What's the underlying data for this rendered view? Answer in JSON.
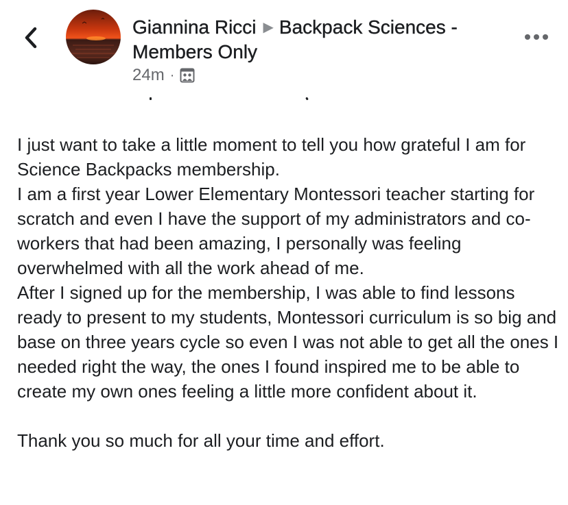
{
  "header": {
    "author": "Giannina Ricci",
    "group": "Backpack Sciences - Members Only",
    "time": "24m",
    "privacy_icon": "members-group-icon",
    "back_icon": "chevron-left-icon",
    "more_icon": "more-horizontal-icon"
  },
  "post": {
    "paragraphs": [
      "I just want to take a little moment to tell you how grateful I am for Science Backpacks membership.",
      "I am a first year Lower Elementary Montessori teacher starting for scratch and even I have the support of my administrators and co-workers that had been amazing, I personally was feeling overwhelmed with all the work ahead of me.",
      "After I signed up for the membership, I was able to find lessons ready to present to my students, Montessori curriculum is so big and base on three years cycle so even I was not able to get all the ones I needed right the way, the ones I found inspired me to be able to create my own ones feeling a little more confident about it.",
      "Thank you so much for all your time and effort."
    ]
  },
  "colors": {
    "text": "#1c1e21",
    "secondary": "#65676b",
    "arrow": "#8a8d91"
  }
}
